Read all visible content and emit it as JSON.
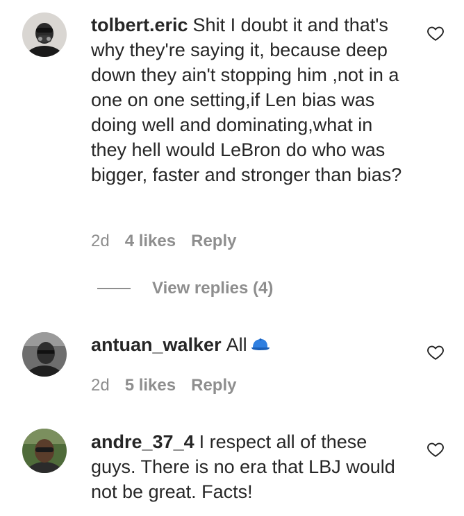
{
  "comments": [
    {
      "username": "tolbert.eric",
      "text": "Shit I doubt it and that's why they're saying it, because deep down they ain't stopping him ,not in a one on one setting,if Len bias was doing well and dominating,what in they hell would LeBron do who was bigger, faster and stronger than bias?",
      "time": "2d",
      "likes": "4 likes",
      "reply_label": "Reply",
      "avatar_icon": "avatar-masked-man"
    },
    {
      "username": "antuan_walker",
      "text": "All",
      "emoji": "blue-cap-emoji",
      "time": "2d",
      "likes": "5 likes",
      "reply_label": "Reply",
      "avatar_icon": "avatar-man-dark"
    },
    {
      "username": "andre_37_4",
      "text": "I respect all of these guys. There is no era that LBJ would not be great. Facts!",
      "avatar_icon": "avatar-man-glasses"
    }
  ],
  "view_replies": "View replies (4)",
  "colors": {
    "text": "#262626",
    "secondary": "#8e8e8e",
    "background": "#ffffff"
  },
  "icons": {
    "like": "heart-outline-icon"
  }
}
